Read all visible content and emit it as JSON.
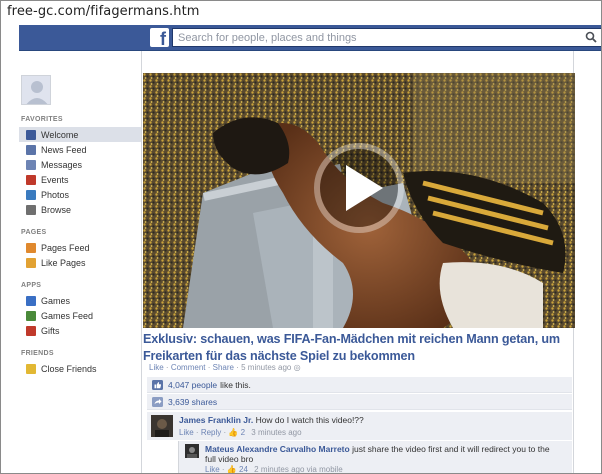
{
  "browser": {
    "url": "free-gc.com/fifagermans.htm"
  },
  "header": {
    "logo_letter": "f",
    "search_placeholder": "Search for people, places and things"
  },
  "sidebar": {
    "sections": [
      {
        "title": "FAVORITES",
        "items": [
          {
            "label": "Welcome",
            "icon": "facebook-icon",
            "color": "#3b5998",
            "active": true
          },
          {
            "label": "News Feed",
            "icon": "news-feed-icon",
            "color": "#5b74a8"
          },
          {
            "label": "Messages",
            "icon": "messages-icon",
            "color": "#6d84b4"
          },
          {
            "label": "Events",
            "icon": "calendar-icon",
            "color": "#c0392b"
          },
          {
            "label": "Photos",
            "icon": "photos-icon",
            "color": "#3a7bbf"
          },
          {
            "label": "Browse",
            "icon": "magnifier-icon",
            "color": "#6f6f6f"
          }
        ]
      },
      {
        "title": "PAGES",
        "items": [
          {
            "label": "Pages Feed",
            "icon": "flag-icon",
            "color": "#e0892e"
          },
          {
            "label": "Like Pages",
            "icon": "thumbs-up-icon",
            "color": "#e2a233"
          }
        ]
      },
      {
        "title": "APPS",
        "items": [
          {
            "label": "Games",
            "icon": "games-icon",
            "color": "#3a6fc4"
          },
          {
            "label": "Games Feed",
            "icon": "games-feed-icon",
            "color": "#4a8a3a"
          },
          {
            "label": "Gifts",
            "icon": "gift-icon",
            "color": "#c0392b"
          }
        ]
      },
      {
        "title": "FRIENDS",
        "items": [
          {
            "label": "Close Friends",
            "icon": "star-icon",
            "color": "#e2b833"
          }
        ]
      }
    ]
  },
  "post": {
    "headline": "Exklusiv: schauen, was FIFA-Fan-Mädchen mit reichen Mann getan, um Freikarten für das nächste Spiel zu bekommen",
    "actions": {
      "like": "Like",
      "comment": "Comment",
      "share": "Share",
      "time": "5 minutes ago"
    },
    "likes": {
      "count": "4,047 people",
      "suffix": "like this."
    },
    "shares": "3,639 shares",
    "comments": [
      {
        "name": "James Franklin Jr.",
        "text": "How do I watch this video!??",
        "like": "Like",
        "reply": "Reply",
        "likes": "2",
        "time": "3 minutes ago"
      },
      {
        "name": "Mateus Alexandre Carvalho Marreto",
        "text": "just share the video first and it will redirect you to the",
        "text2": "full video bro",
        "like": "Like",
        "likes": "24",
        "time": "2 minutes ago via mobile"
      }
    ]
  }
}
